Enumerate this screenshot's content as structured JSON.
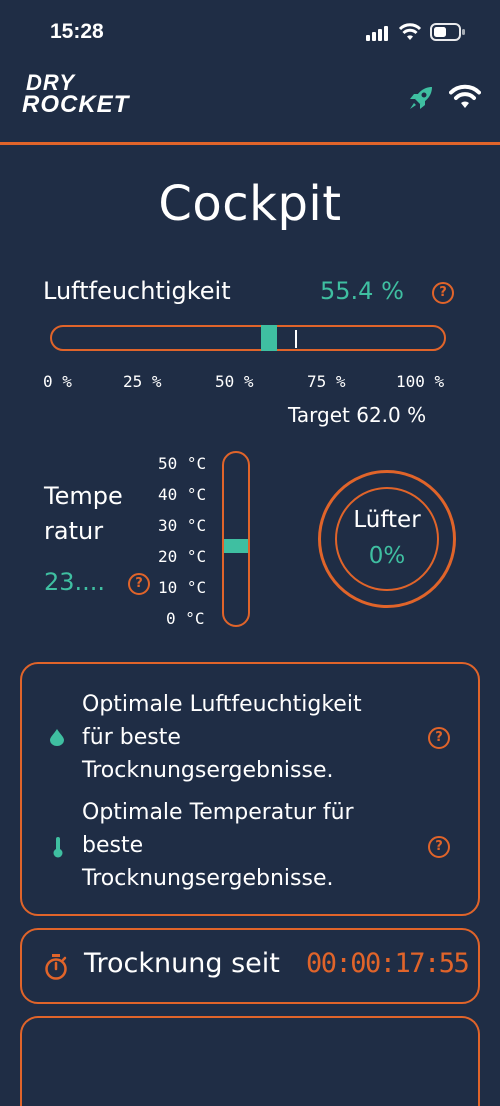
{
  "status_bar": {
    "time": "15:28"
  },
  "header": {
    "logo_line1": "DRY",
    "logo_line2": "ROCKET"
  },
  "page": {
    "title": "Cockpit"
  },
  "humidity": {
    "label": "Luftfeuchtigkeit",
    "value": "55.4 %",
    "scale": [
      "0 %",
      "25 %",
      "50 %",
      "75 %",
      "100 %"
    ],
    "target": "Target 62.0 %",
    "current_fraction": 0.554,
    "target_fraction": 0.62
  },
  "temperature": {
    "label_line1": "Tempe",
    "label_line2": "ratur",
    "value": "23....",
    "scale": [
      "50 °C",
      "40 °C",
      "30 °C",
      "20 °C",
      "10 °C",
      "0 °C"
    ],
    "current_fraction": 0.46
  },
  "fan": {
    "label": "Lüfter",
    "value": "0%"
  },
  "messages": [
    {
      "icon": "droplet-icon",
      "text_lines": [
        "Optimale Luftfeuchtigkeit",
        "für beste",
        "Trocknungsergebnisse."
      ]
    },
    {
      "icon": "thermometer-icon",
      "text_lines": [
        "Optimale Temperatur für",
        "beste",
        "Trocknungsergebnisse."
      ]
    }
  ],
  "drying": {
    "label": "Trocknung seit",
    "elapsed": "00:00:17:55"
  },
  "colors": {
    "background": "#1f2d45",
    "accent": "#e0642a",
    "teal": "#3fbfa1"
  }
}
